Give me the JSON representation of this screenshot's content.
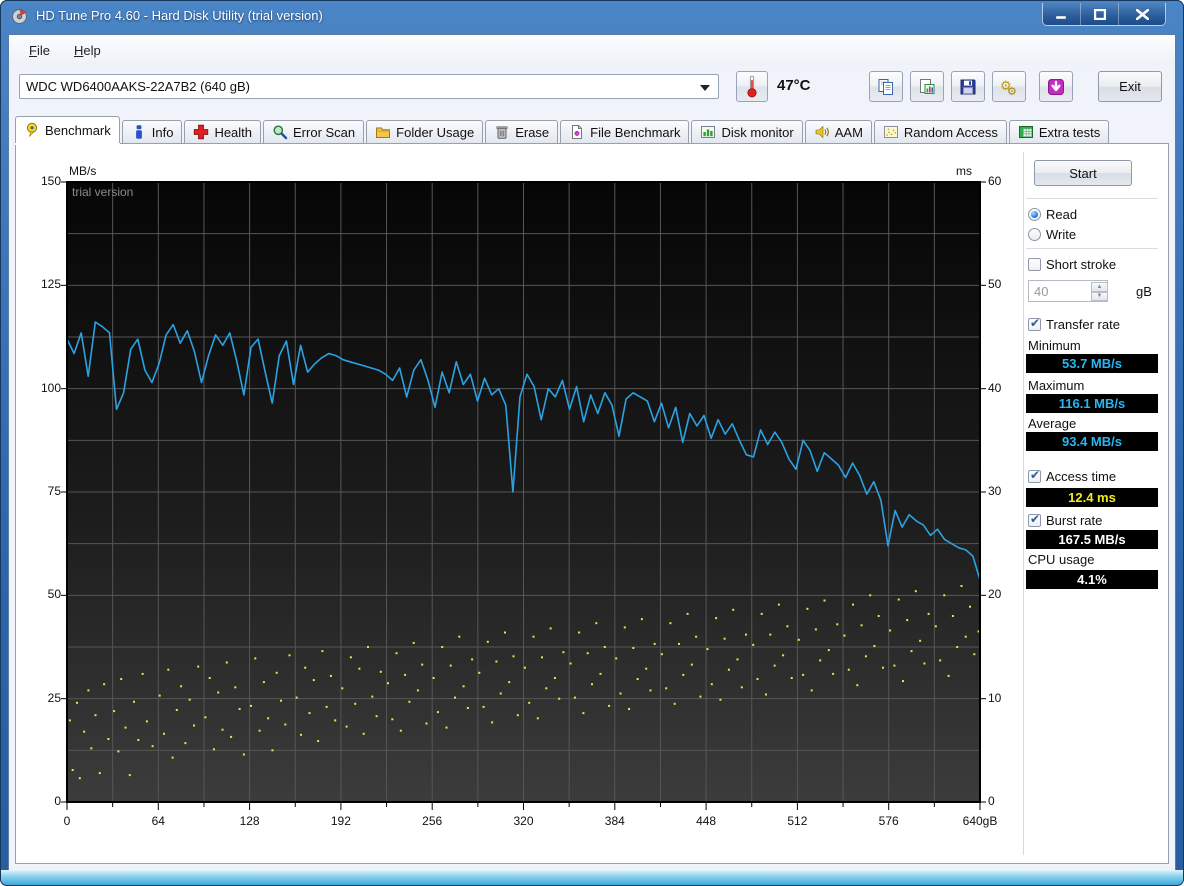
{
  "window": {
    "title": "HD Tune Pro 4.60 - Hard Disk Utility (trial version)",
    "controls": [
      "minimize",
      "maximize",
      "close"
    ]
  },
  "menu": {
    "items": [
      {
        "label": "File"
      },
      {
        "label": "Help"
      }
    ]
  },
  "toolbar": {
    "drive": "WDC WD6400AAKS-22A7B2 (640 gB)",
    "temperature": "47°C",
    "buttons": [
      {
        "name": "copy-text-button",
        "icon": "copy"
      },
      {
        "name": "copy-image-button",
        "icon": "copy-image"
      },
      {
        "name": "save-button",
        "icon": "save"
      },
      {
        "name": "options-button",
        "icon": "options"
      },
      {
        "name": "download-button",
        "icon": "download"
      }
    ],
    "exit_label": "Exit"
  },
  "tabs": [
    {
      "label": "Benchmark",
      "icon": "benchmark",
      "active": true
    },
    {
      "label": "Info",
      "icon": "info",
      "active": false
    },
    {
      "label": "Health",
      "icon": "health",
      "active": false
    },
    {
      "label": "Error Scan",
      "icon": "error-scan",
      "active": false
    },
    {
      "label": "Folder Usage",
      "icon": "folder-usage",
      "active": false
    },
    {
      "label": "Erase",
      "icon": "erase",
      "active": false
    },
    {
      "label": "File Benchmark",
      "icon": "file-benchmark",
      "active": false
    },
    {
      "label": "Disk monitor",
      "icon": "disk-monitor",
      "active": false
    },
    {
      "label": "AAM",
      "icon": "aam",
      "active": false
    },
    {
      "label": "Random Access",
      "icon": "random-access",
      "active": false
    },
    {
      "label": "Extra tests",
      "icon": "extra-tests",
      "active": false
    }
  ],
  "benchmark": {
    "start_label": "Start",
    "mode": {
      "read_label": "Read",
      "write_label": "Write",
      "selected": "Read"
    },
    "short_stroke": {
      "label": "Short stroke",
      "checked": false,
      "capacity_value": "40",
      "capacity_unit": "gB"
    },
    "transfer_rate": {
      "label": "Transfer rate",
      "checked": true,
      "value_color": "#29b6f2",
      "minimum": {
        "label": "Minimum",
        "value": "53.7 MB/s"
      },
      "maximum": {
        "label": "Maximum",
        "value": "116.1 MB/s"
      },
      "average": {
        "label": "Average",
        "value": "93.4 MB/s"
      }
    },
    "access_time": {
      "label": "Access time",
      "checked": true,
      "value": "12.4 ms",
      "value_color": "#f0ec1c"
    },
    "burst_rate": {
      "label": "Burst rate",
      "checked": true,
      "value": "167.5 MB/s",
      "value_color": "#ffffff"
    },
    "cpu_usage": {
      "label": "CPU usage",
      "value": "4.1%",
      "value_color": "#ffffff"
    }
  },
  "chart_data": {
    "type": "line",
    "watermark": "trial version",
    "bg_top": "#060606",
    "bg_bottom": "#3c3c3c",
    "grid_color": "#565656",
    "left_axis": {
      "label": "MB/s",
      "min": 0,
      "max": 150,
      "tick_step": 25,
      "grid_step": 12.5,
      "ticks": [
        0,
        25,
        50,
        75,
        100,
        125,
        150
      ]
    },
    "right_axis": {
      "label": "ms",
      "min": 0,
      "max": 60,
      "tick_step": 10,
      "ticks": [
        0,
        10,
        20,
        30,
        40,
        50,
        60
      ]
    },
    "x_axis": {
      "min": 0,
      "max": 640,
      "grid_step": 32,
      "tick_values": [
        0,
        64,
        128,
        192,
        256,
        320,
        384,
        448,
        512,
        576,
        640
      ],
      "tick_labels": [
        "0",
        "64",
        "128",
        "192",
        "256",
        "320",
        "384",
        "448",
        "512",
        "576",
        "640gB"
      ]
    },
    "series": [
      {
        "name": "Transfer rate",
        "type": "line",
        "color": "#2ba2e2",
        "axis": "left",
        "x_range_gb": [
          0,
          640
        ],
        "values": [
          112.0,
          108.5,
          113.5,
          103.0,
          116.1,
          115.0,
          113.5,
          95.0,
          99.0,
          109.5,
          112.0,
          104.5,
          101.5,
          106.0,
          113.0,
          115.5,
          111.0,
          114.0,
          109.0,
          101.5,
          108.0,
          113.0,
          110.5,
          113.5,
          106.5,
          98.5,
          110.0,
          112.0,
          104.0,
          96.5,
          108.0,
          111.5,
          101.0,
          110.5,
          104.0,
          106.0,
          107.5,
          108.5,
          108.0,
          107.0,
          106.5,
          106.0,
          105.5,
          105.0,
          104.5,
          103.5,
          102.0,
          105.0,
          98.0,
          104.5,
          107.0,
          102.0,
          95.5,
          104.0,
          99.0,
          106.5,
          101.0,
          103.5,
          97.0,
          102.5,
          98.5,
          100.0,
          96.0,
          75.0,
          98.0,
          103.5,
          100.5,
          92.5,
          100.0,
          98.0,
          102.0,
          95.0,
          100.5,
          92.0,
          98.5,
          94.0,
          99.0,
          96.0,
          88.5,
          97.5,
          99.0,
          98.0,
          97.0,
          92.0,
          96.5,
          90.5,
          95.5,
          87.0,
          94.0,
          91.0,
          93.5,
          88.0,
          92.5,
          89.0,
          91.5,
          87.5,
          84.0,
          83.5,
          90.0,
          86.5,
          89.5,
          87.0,
          83.0,
          80.5,
          87.5,
          85.0,
          80.0,
          84.5,
          83.0,
          81.5,
          78.5,
          82.0,
          79.0,
          74.5,
          77.5,
          73.0,
          62.0,
          70.5,
          66.5,
          69.5,
          68.0,
          67.0,
          64.5,
          66.0,
          63.5,
          62.5,
          61.5,
          61.0,
          59.5,
          53.7
        ]
      },
      {
        "name": "Access time",
        "type": "scatter",
        "color": "#e8e44c",
        "axis": "right",
        "points": [
          [
            2,
            7.9
          ],
          [
            4,
            3.1
          ],
          [
            7,
            9.6
          ],
          [
            9,
            2.3
          ],
          [
            12,
            6.8
          ],
          [
            15,
            10.8
          ],
          [
            17,
            5.2
          ],
          [
            20,
            8.4
          ],
          [
            23,
            2.8
          ],
          [
            26,
            11.4
          ],
          [
            29,
            6.1
          ],
          [
            33,
            8.8
          ],
          [
            36,
            4.9
          ],
          [
            38,
            11.9
          ],
          [
            41,
            7.2
          ],
          [
            44,
            2.6
          ],
          [
            47,
            9.7
          ],
          [
            50,
            6.0
          ],
          [
            53,
            12.4
          ],
          [
            56,
            7.8
          ],
          [
            60,
            5.4
          ],
          [
            65,
            10.3
          ],
          [
            68,
            6.6
          ],
          [
            71,
            12.8
          ],
          [
            74,
            4.3
          ],
          [
            77,
            8.9
          ],
          [
            80,
            11.2
          ],
          [
            83,
            5.7
          ],
          [
            86,
            9.9
          ],
          [
            89,
            7.4
          ],
          [
            92,
            13.1
          ],
          [
            97,
            8.2
          ],
          [
            100,
            12.0
          ],
          [
            103,
            5.1
          ],
          [
            106,
            10.6
          ],
          [
            109,
            7.0
          ],
          [
            112,
            13.5
          ],
          [
            115,
            6.3
          ],
          [
            118,
            11.1
          ],
          [
            121,
            9.0
          ],
          [
            124,
            4.6
          ],
          [
            129,
            9.3
          ],
          [
            132,
            13.9
          ],
          [
            135,
            6.9
          ],
          [
            138,
            11.6
          ],
          [
            141,
            8.1
          ],
          [
            144,
            5.0
          ],
          [
            147,
            12.5
          ],
          [
            150,
            9.8
          ],
          [
            153,
            7.5
          ],
          [
            156,
            14.2
          ],
          [
            161,
            10.1
          ],
          [
            164,
            6.5
          ],
          [
            167,
            13.0
          ],
          [
            170,
            8.6
          ],
          [
            173,
            11.8
          ],
          [
            176,
            5.9
          ],
          [
            179,
            14.6
          ],
          [
            182,
            9.2
          ],
          [
            185,
            12.2
          ],
          [
            188,
            7.9
          ],
          [
            193,
            11.0
          ],
          [
            196,
            7.3
          ],
          [
            199,
            14.0
          ],
          [
            202,
            9.5
          ],
          [
            205,
            12.9
          ],
          [
            208,
            6.6
          ],
          [
            211,
            15.0
          ],
          [
            214,
            10.2
          ],
          [
            217,
            8.3
          ],
          [
            220,
            12.6
          ],
          [
            225,
            11.5
          ],
          [
            228,
            8.0
          ],
          [
            231,
            14.4
          ],
          [
            234,
            6.9
          ],
          [
            237,
            12.3
          ],
          [
            240,
            9.7
          ],
          [
            243,
            15.4
          ],
          [
            246,
            10.8
          ],
          [
            249,
            13.3
          ],
          [
            252,
            7.6
          ],
          [
            257,
            12.0
          ],
          [
            260,
            8.7
          ],
          [
            263,
            15.0
          ],
          [
            266,
            7.2
          ],
          [
            269,
            13.2
          ],
          [
            272,
            10.1
          ],
          [
            275,
            16.0
          ],
          [
            278,
            11.2
          ],
          [
            281,
            9.1
          ],
          [
            284,
            13.8
          ],
          [
            289,
            12.5
          ],
          [
            292,
            9.2
          ],
          [
            295,
            15.5
          ],
          [
            298,
            7.7
          ],
          [
            301,
            13.6
          ],
          [
            304,
            10.5
          ],
          [
            307,
            16.4
          ],
          [
            310,
            11.6
          ],
          [
            313,
            14.1
          ],
          [
            316,
            8.4
          ],
          [
            321,
            13.0
          ],
          [
            324,
            9.6
          ],
          [
            327,
            16.0
          ],
          [
            330,
            8.1
          ],
          [
            333,
            14.0
          ],
          [
            336,
            11.0
          ],
          [
            339,
            16.8
          ],
          [
            342,
            12.0
          ],
          [
            345,
            10.0
          ],
          [
            348,
            14.5
          ],
          [
            353,
            13.4
          ],
          [
            356,
            10.1
          ],
          [
            359,
            16.4
          ],
          [
            362,
            8.6
          ],
          [
            365,
            14.4
          ],
          [
            368,
            11.4
          ],
          [
            371,
            17.3
          ],
          [
            374,
            12.4
          ],
          [
            377,
            15.0
          ],
          [
            380,
            9.3
          ],
          [
            385,
            13.9
          ],
          [
            388,
            10.5
          ],
          [
            391,
            16.9
          ],
          [
            394,
            9.0
          ],
          [
            397,
            14.9
          ],
          [
            400,
            11.9
          ],
          [
            403,
            17.7
          ],
          [
            406,
            12.9
          ],
          [
            409,
            10.8
          ],
          [
            412,
            15.3
          ],
          [
            417,
            14.3
          ],
          [
            420,
            11.0
          ],
          [
            423,
            17.3
          ],
          [
            426,
            9.5
          ],
          [
            429,
            15.3
          ],
          [
            432,
            12.3
          ],
          [
            435,
            18.2
          ],
          [
            438,
            13.3
          ],
          [
            441,
            16.0
          ],
          [
            444,
            10.2
          ],
          [
            449,
            14.8
          ],
          [
            452,
            11.4
          ],
          [
            455,
            17.8
          ],
          [
            458,
            9.9
          ],
          [
            461,
            15.8
          ],
          [
            464,
            12.8
          ],
          [
            467,
            18.6
          ],
          [
            470,
            13.8
          ],
          [
            473,
            11.1
          ],
          [
            476,
            16.2
          ],
          [
            481,
            15.2
          ],
          [
            484,
            11.9
          ],
          [
            487,
            18.2
          ],
          [
            490,
            10.4
          ],
          [
            493,
            16.2
          ],
          [
            496,
            13.2
          ],
          [
            499,
            19.1
          ],
          [
            502,
            14.2
          ],
          [
            505,
            17.0
          ],
          [
            508,
            12.0
          ],
          [
            513,
            15.7
          ],
          [
            516,
            12.3
          ],
          [
            519,
            18.7
          ],
          [
            522,
            10.8
          ],
          [
            525,
            16.7
          ],
          [
            528,
            13.7
          ],
          [
            531,
            19.5
          ],
          [
            534,
            14.7
          ],
          [
            537,
            12.4
          ],
          [
            540,
            17.2
          ],
          [
            545,
            16.1
          ],
          [
            548,
            12.8
          ],
          [
            551,
            19.1
          ],
          [
            554,
            11.3
          ],
          [
            557,
            17.1
          ],
          [
            560,
            14.1
          ],
          [
            563,
            20.0
          ],
          [
            566,
            15.1
          ],
          [
            569,
            18.0
          ],
          [
            572,
            13.0
          ],
          [
            577,
            16.6
          ],
          [
            580,
            13.2
          ],
          [
            583,
            19.6
          ],
          [
            586,
            11.7
          ],
          [
            589,
            17.6
          ],
          [
            592,
            14.6
          ],
          [
            595,
            20.4
          ],
          [
            598,
            15.6
          ],
          [
            601,
            13.4
          ],
          [
            604,
            18.2
          ],
          [
            609,
            17.0
          ],
          [
            612,
            13.7
          ],
          [
            615,
            20.0
          ],
          [
            618,
            12.2
          ],
          [
            621,
            18.0
          ],
          [
            624,
            15.0
          ],
          [
            627,
            20.9
          ],
          [
            630,
            16.0
          ],
          [
            633,
            18.9
          ],
          [
            636,
            14.3
          ],
          [
            639,
            16.5
          ]
        ]
      }
    ]
  }
}
